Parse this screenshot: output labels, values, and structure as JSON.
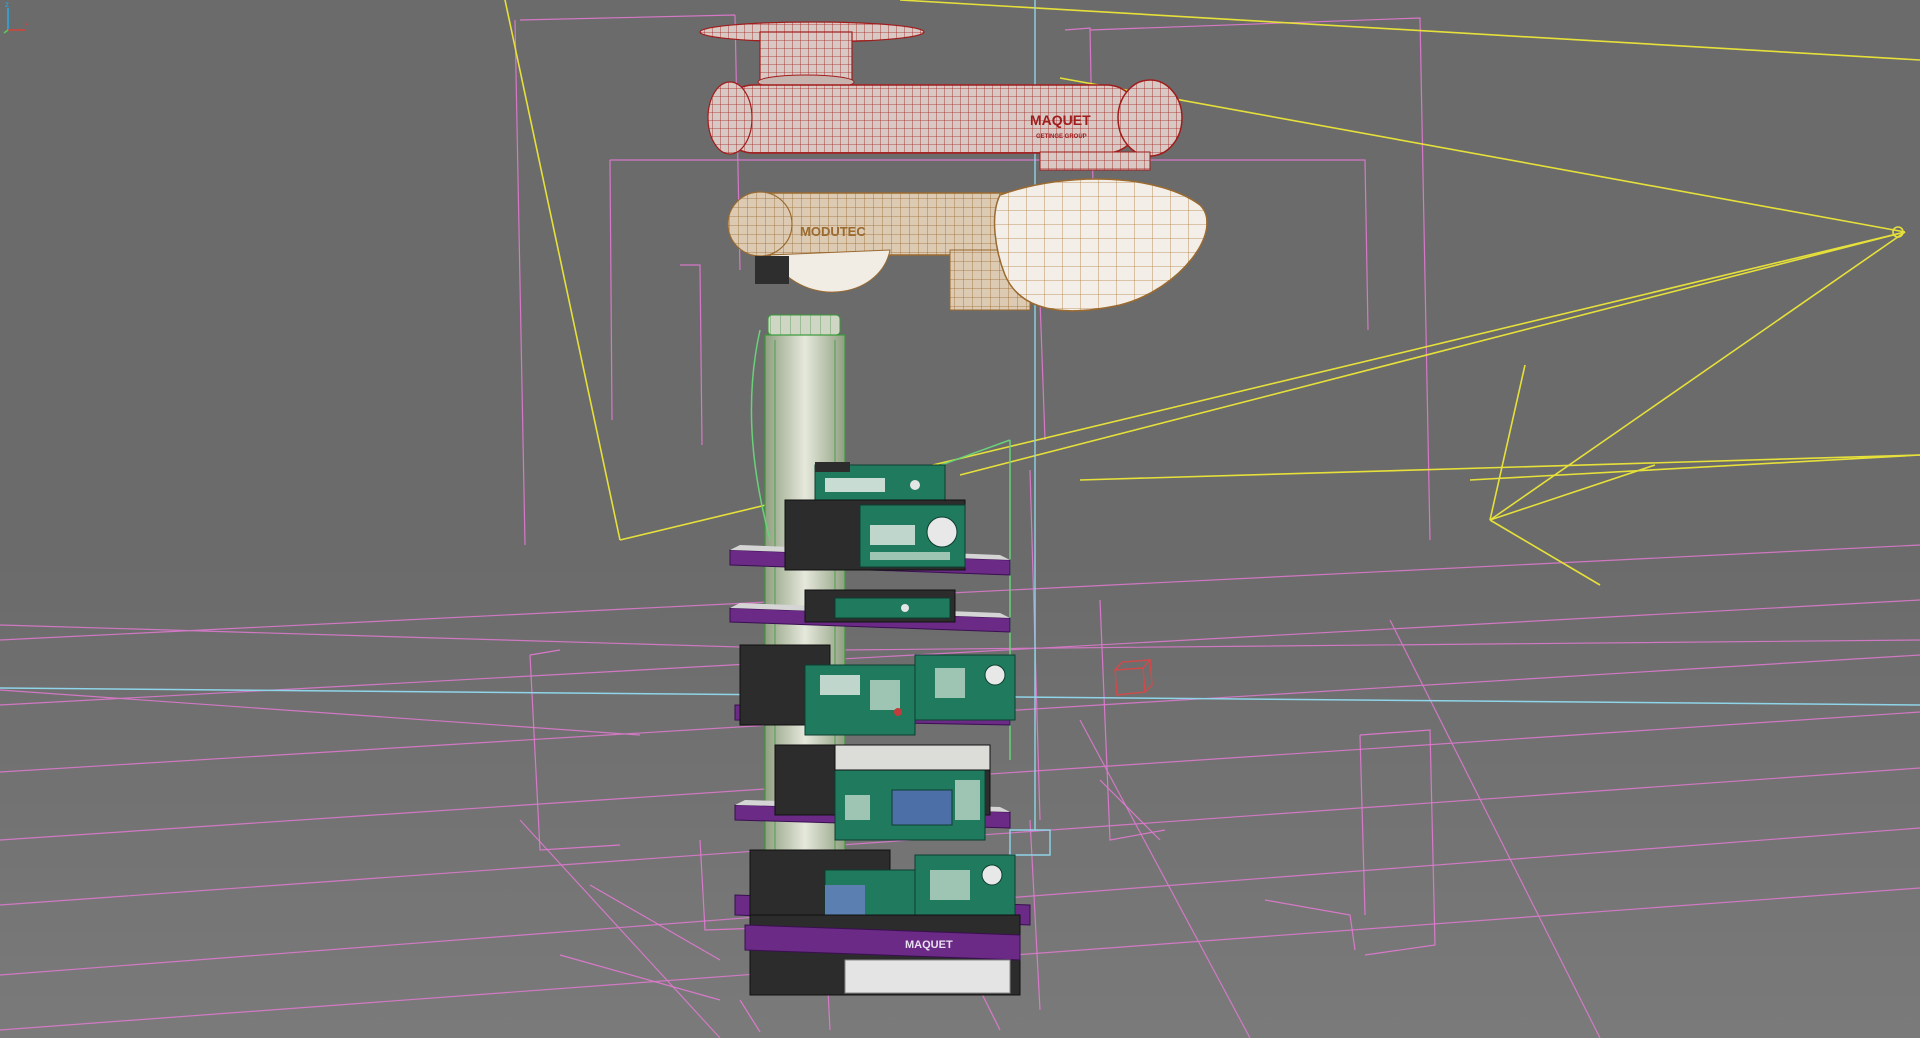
{
  "app": {
    "name": "3D modeling viewport (wireframe / shaded)"
  },
  "viewport": {
    "background": "#6b6b6b",
    "axis_label_z": "z",
    "axis_label_x": "x"
  },
  "colors": {
    "grid_pink": "#e27ad2",
    "light_yellow": "#e6e03a",
    "guide_cyan": "#8fd4e8",
    "cable_green": "#6ad07a",
    "device_green": "#1f7a5e",
    "device_dark": "#2c2c2c",
    "shelf_purple": "#6a2a86",
    "arm_red": "#a11c1c",
    "arm_tan": "#b8874a",
    "pillar_green": "#3a9a3a"
  },
  "model": {
    "upper_arm_brand": "MAQUET",
    "upper_arm_subtitle": "GETINGE GROUP",
    "lower_arm_brand": "MODUTEC",
    "base_label": "MAQUET"
  }
}
